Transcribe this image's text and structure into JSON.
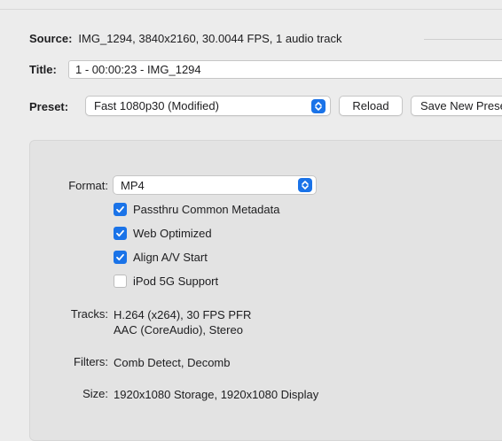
{
  "source": {
    "label": "Source:",
    "value": "IMG_1294, 3840x2160, 30.0044 FPS, 1 audio track"
  },
  "title": {
    "label": "Title:",
    "value": "1 - 00:00:23 - IMG_1294"
  },
  "preset": {
    "label": "Preset:",
    "selected": "Fast 1080p30 (Modified)",
    "reload_label": "Reload",
    "save_label": "Save New Preset"
  },
  "summary": {
    "format_label": "Format:",
    "format_value": "MP4",
    "checkboxes": [
      {
        "label": "Passthru Common Metadata",
        "checked": true
      },
      {
        "label": "Web Optimized",
        "checked": true
      },
      {
        "label": "Align A/V Start",
        "checked": true
      },
      {
        "label": "iPod 5G Support",
        "checked": false
      }
    ],
    "tracks_label": "Tracks:",
    "tracks_lines": [
      "H.264 (x264), 30 FPS PFR",
      "AAC (CoreAudio), Stereo"
    ],
    "filters_label": "Filters:",
    "filters_value": "Comb Detect, Decomb",
    "size_label": "Size:",
    "size_value": "1920x1080 Storage, 1920x1080 Display"
  },
  "colors": {
    "accent": "#1a73e8",
    "window_bg": "#ececec",
    "panel_bg": "#e3e3e3"
  },
  "icons": {
    "popup": "chevron-up-down-icon",
    "check": "checkmark-icon"
  }
}
